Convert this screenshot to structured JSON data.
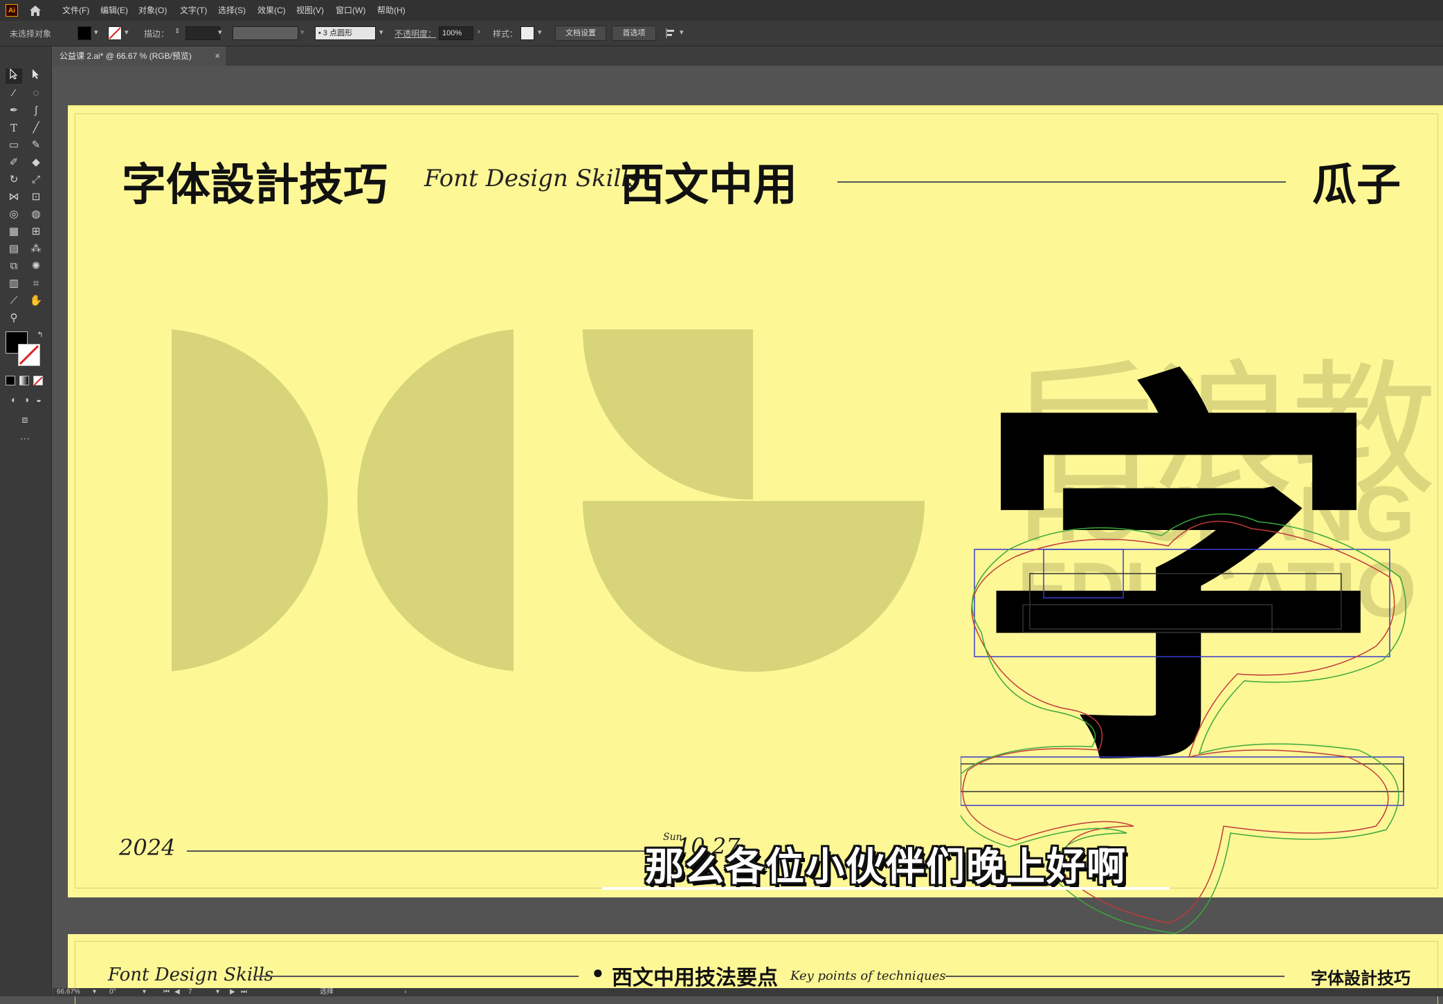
{
  "app": {
    "logo": "Ai"
  },
  "menu": [
    "文件(F)",
    "编辑(E)",
    "对象(O)",
    "文字(T)",
    "选择(S)",
    "效果(C)",
    "视图(V)",
    "窗口(W)",
    "帮助(H)"
  ],
  "control_bar": {
    "selection_label": "未选择对象",
    "stroke_label": "描边：",
    "brush_value": "3 点圆形",
    "opacity_label": "不透明度：",
    "opacity_value": "100%",
    "style_label": "样式：",
    "doc_setup_button": "文档设置",
    "prefs_button": "首选项"
  },
  "document_tab": {
    "title": "公益课 2.ai* @ 66.67 % (RGB/预览)",
    "close": "×"
  },
  "artboard": {
    "title_cn": "字体設計技巧",
    "title_en": "Font Design Skills",
    "subtitle_cn": "西文中用",
    "author": "瓜子",
    "watermark_cn": "后浪教",
    "watermark_en_1": "HOULANG",
    "watermark_en_2": "EDUCATIO",
    "hero_glyph": "字",
    "year": "2024",
    "date_partial": "10.27",
    "weekday": "Sun."
  },
  "artboard2": {
    "left_text": "Font Design Skills",
    "bullet": "●",
    "center_cn": "西文中用技法要点",
    "center_en": "Key points of techniques",
    "right_cn": "字体設計技巧"
  },
  "status_bar": {
    "zoom": "66.67%",
    "rotation": "0°",
    "artboard_num": "7",
    "mode": "选择"
  },
  "subtitle": "那么各位小伙伴们晚上好啊",
  "colors": {
    "artboard_bg": "#fdf796",
    "shape_fill": "#d8d47a",
    "ui_dark": "#323232",
    "accent_outline_blue": "#3a3acd",
    "accent_outline_red": "#c23a3a",
    "accent_outline_green": "#3aa83a"
  }
}
